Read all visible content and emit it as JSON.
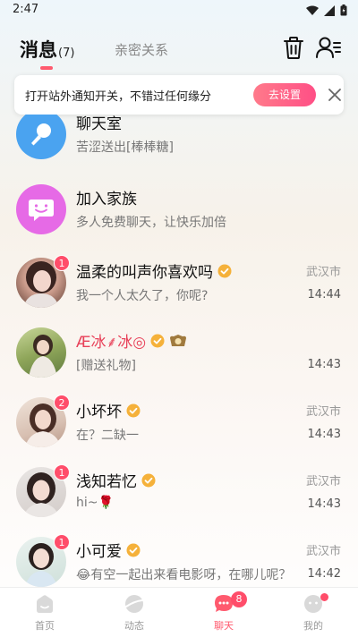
{
  "status_bar": {
    "time": "2:47"
  },
  "top_nav": {
    "tab_messages": "消息",
    "tab_messages_count": "(7)",
    "tab_intimate": "亲密关系"
  },
  "notify_banner": {
    "text": "打开站外通知开关，不错过任何缘分",
    "button": "去设置"
  },
  "conversations": [
    {
      "name": "聊天室",
      "preview": "苦涩送出[棒棒糖]",
      "avatar": "microphone-icon"
    },
    {
      "name": "加入家族",
      "preview": "多人免费聊天，让快乐加倍",
      "avatar": "smiley-chat-icon"
    },
    {
      "name": "温柔的叫声你喜欢吗",
      "preview": "我一个人太久了，你呢?",
      "location": "武汉市",
      "time": "14:44",
      "badge": "1"
    },
    {
      "name": "Æ冰⸙冰◎",
      "preview": "[赠送礼物]",
      "location": "",
      "time": "14:43",
      "badge": ""
    },
    {
      "name": "小坏坏",
      "preview": "在？二缺一",
      "location": "武汉市",
      "time": "14:43",
      "badge": "2"
    },
    {
      "name": "浅知若忆",
      "preview": "hi~🌹",
      "location": "武汉市",
      "time": "14:43",
      "badge": "1"
    },
    {
      "name": "小可爱",
      "preview": "😂有空一起出来看电影呀，在哪儿呢？",
      "location": "武汉市",
      "time": "14:42",
      "badge": "1"
    }
  ],
  "bottom_nav": {
    "home": "首页",
    "moments": "动态",
    "chat": "聊天",
    "chat_badge": "8",
    "mine": "我的"
  },
  "colors": {
    "accent": "#ff5a6e",
    "verified": "#f5b13a",
    "chatroom_blue": "#4aa3f0",
    "family_pink": "#e66ae6"
  }
}
